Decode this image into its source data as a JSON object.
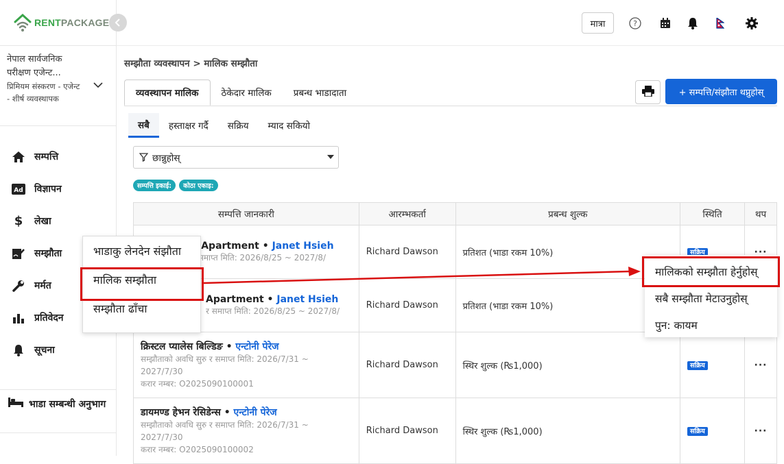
{
  "brand": {
    "logo_text_a": "RENT",
    "logo_text_b": "PACKAGE",
    "accent": "#3aa54a"
  },
  "org": {
    "name": "नेपाल सार्वजनिक परीक्षण एजेन्ट...",
    "subtitle": "प्रिमियम संस्करण - एजेन्ट - शीर्ष व्यवस्थापक"
  },
  "nav": {
    "items": [
      {
        "label": "सम्पत्ति",
        "icon": "home-icon"
      },
      {
        "label": "विज्ञापन",
        "icon": "ad-icon"
      },
      {
        "label": "लेखा",
        "icon": "dollar-icon"
      },
      {
        "label": "सम्झौता",
        "icon": "contract-icon"
      },
      {
        "label": "मर्मत",
        "icon": "wrench-icon"
      },
      {
        "label": "प्रतिवेदन",
        "icon": "bar-chart-icon"
      },
      {
        "label": "सूचना",
        "icon": "bell-icon"
      }
    ],
    "bottom_label": "भाडा सम्बन्धी अनुभाग"
  },
  "topbar": {
    "unit_label": "मात्रा"
  },
  "breadcrumb": "सम्झौता व्यवस्थापन > मालिक सम्झौता",
  "tabs_main": [
    "व्यवस्थापन मालिक",
    "ठेकेदार मालिक",
    "प्रबन्ध भाडादाता"
  ],
  "add_button": "+ सम्पत्ति/संझौता थप्नुहोस्",
  "tabs_sub": [
    "सबै",
    "हस्ताक्षर गर्दै",
    "सक्रिय",
    "म्याद सकियो"
  ],
  "filter": {
    "placeholder": "छान्नुहोस्"
  },
  "chips": [
    "सम्पत्ति इकाई:",
    "कोठा एकाइ:"
  ],
  "table": {
    "headers": [
      "सम्पत्ति जानकारी",
      "आरम्भकर्ता",
      "प्रबन्ध शुल्क",
      "स्थिति",
      "थप"
    ],
    "rows": [
      {
        "title": "s Apartment",
        "agent": "Janet Hsieh",
        "period": "र समाप्त मिति: 2026/8/25 ~ 2027/8/",
        "initiator": "Richard Dawson",
        "fee": "प्रतिशत (भाडा रकम 10%)",
        "status": "सक्रिय"
      },
      {
        "title": "Apartment",
        "agent": "Janet Hsieh",
        "period": "र समाप्त मिति: 2026/8/25 ~ 2027/8/",
        "initiator": "Richard Dawson",
        "fee": "प्रतिशत (भाडा रकम 10%)",
        "status": ""
      },
      {
        "title": "क्रिस्टल प्यालेस बिल्डिङ",
        "agent": "एन्टोनी पेरेज",
        "period": "सम्झौताको अवधि सुरु र समाप्त मिति: 2026/7/31 ~ 2027/7/30",
        "contract": "करार नम्बर: O2025090100001",
        "initiator": "Richard Dawson",
        "fee": "स्थिर शुल्क (₨1,000)",
        "status": "सक्रिय"
      },
      {
        "title": "डायमण्ड हेभन रेसिडेन्स",
        "agent": "एन्टोनी पेरेज",
        "period": "सम्झौताको अवधि सुरु र समाप्त मिति: 2026/7/31 ~ 2027/7/30",
        "contract": "करार नम्बर: O2025090100002",
        "initiator": "Richard Dawson",
        "fee": "स्थिर शुल्क (₨1,000)",
        "status": "सक्रिय"
      }
    ]
  },
  "popup_menu": [
    "भाडाकु लेनदेन संझौता",
    "मालिक सम्झौता",
    "सम्झौता ढाँचा"
  ],
  "row_menu": [
    "मालिकको सम्झौता हेर्नुहोस्",
    "सबै सम्झौता मेटाउनुहोस्",
    "पुन: कायम"
  ],
  "colors": {
    "primary": "#1565d8",
    "highlight": "#d91010",
    "chip": "#1ea7b5"
  }
}
